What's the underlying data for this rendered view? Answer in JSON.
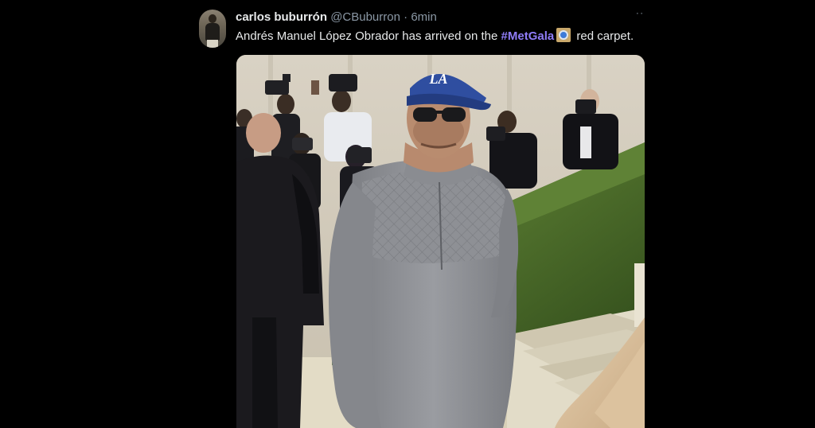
{
  "tweet": {
    "author": {
      "display_name": "carlos buburrón",
      "handle": "@CBuburron"
    },
    "separator": "·",
    "time": "6min",
    "text": {
      "before": "Andrés Manuel López Obrador has arrived on the ",
      "hashtag": "#MetGala",
      "after": " red carpet."
    },
    "more_icon": "more-dots-icon",
    "hashflag_icon": "met-gala-hashflag-icon",
    "media": {
      "type": "photo",
      "cap_logo": "LA"
    }
  },
  "colors": {
    "background": "#000000",
    "text": "#e7e9ea",
    "muted": "#8b98a5",
    "hashtag": "#8f7cf7"
  }
}
